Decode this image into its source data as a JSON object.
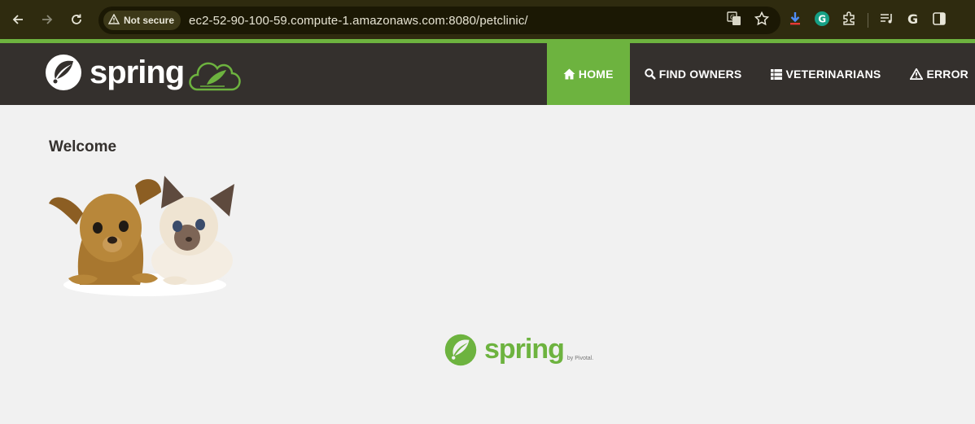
{
  "browser": {
    "security_label": "Not secure",
    "url": "ec2-52-90-100-59.compute-1.amazonaws.com:8080/petclinic/",
    "icons": [
      "back-icon",
      "forward-icon",
      "reload-icon",
      "warning-icon",
      "translate-icon",
      "star-icon",
      "download-icon",
      "grammarly-icon",
      "extensions-icon",
      "reading-list-icon",
      "google-icon",
      "side-panel-icon"
    ]
  },
  "navbar": {
    "brand": "spring",
    "items": [
      {
        "label": "Home",
        "icon": "home-icon",
        "active": true
      },
      {
        "label": "Find owners",
        "icon": "search-icon",
        "active": false
      },
      {
        "label": "Veterinarians",
        "icon": "list-icon",
        "active": false
      },
      {
        "label": "Error",
        "icon": "warning-icon",
        "active": false
      }
    ]
  },
  "main": {
    "heading": "Welcome"
  },
  "footer": {
    "brand": "spring",
    "byline": "by Pivotal."
  },
  "colors": {
    "brand_green": "#6db33f",
    "navbar_bg": "#34302d",
    "page_bg": "#f1f1f1",
    "chrome_bg": "#2f2b0f"
  }
}
